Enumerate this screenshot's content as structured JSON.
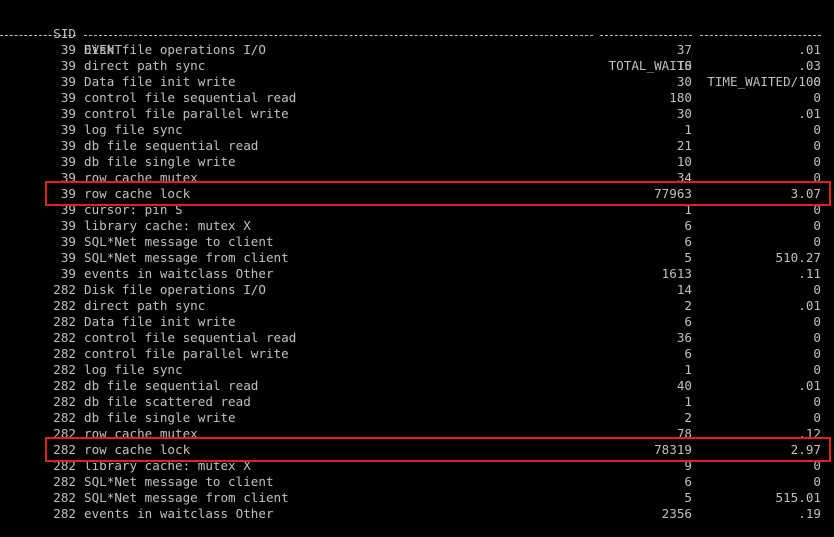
{
  "header": {
    "sid": "SID",
    "event": "EVENT",
    "total_waits": "TOTAL_WAITS",
    "time_waited": "TIME_WAITED/100"
  },
  "rows": [
    {
      "sid": "39",
      "event": "Disk file operations I/O",
      "total_waits": "37",
      "time_waited": ".01"
    },
    {
      "sid": "39",
      "event": "direct path sync",
      "total_waits": "10",
      "time_waited": ".03"
    },
    {
      "sid": "39",
      "event": "Data file init write",
      "total_waits": "30",
      "time_waited": "0"
    },
    {
      "sid": "39",
      "event": "control file sequential read",
      "total_waits": "180",
      "time_waited": "0"
    },
    {
      "sid": "39",
      "event": "control file parallel write",
      "total_waits": "30",
      "time_waited": ".01"
    },
    {
      "sid": "39",
      "event": "log file sync",
      "total_waits": "1",
      "time_waited": "0"
    },
    {
      "sid": "39",
      "event": "db file sequential read",
      "total_waits": "21",
      "time_waited": "0"
    },
    {
      "sid": "39",
      "event": "db file single write",
      "total_waits": "10",
      "time_waited": "0"
    },
    {
      "sid": "39",
      "event": "row cache mutex",
      "total_waits": "34",
      "time_waited": "0"
    },
    {
      "sid": "39",
      "event": "row cache lock",
      "total_waits": "77963",
      "time_waited": "3.07"
    },
    {
      "sid": "39",
      "event": "cursor: pin S",
      "total_waits": "1",
      "time_waited": "0"
    },
    {
      "sid": "39",
      "event": "library cache: mutex X",
      "total_waits": "6",
      "time_waited": "0"
    },
    {
      "sid": "39",
      "event": "SQL*Net message to client",
      "total_waits": "6",
      "time_waited": "0"
    },
    {
      "sid": "39",
      "event": "SQL*Net message from client",
      "total_waits": "5",
      "time_waited": "510.27"
    },
    {
      "sid": "39",
      "event": "events in waitclass Other",
      "total_waits": "1613",
      "time_waited": ".11"
    },
    {
      "sid": "282",
      "event": "Disk file operations I/O",
      "total_waits": "14",
      "time_waited": "0"
    },
    {
      "sid": "282",
      "event": "direct path sync",
      "total_waits": "2",
      "time_waited": ".01"
    },
    {
      "sid": "282",
      "event": "Data file init write",
      "total_waits": "6",
      "time_waited": "0"
    },
    {
      "sid": "282",
      "event": "control file sequential read",
      "total_waits": "36",
      "time_waited": "0"
    },
    {
      "sid": "282",
      "event": "control file parallel write",
      "total_waits": "6",
      "time_waited": "0"
    },
    {
      "sid": "282",
      "event": "log file sync",
      "total_waits": "1",
      "time_waited": "0"
    },
    {
      "sid": "282",
      "event": "db file sequential read",
      "total_waits": "40",
      "time_waited": ".01"
    },
    {
      "sid": "282",
      "event": "db file scattered read",
      "total_waits": "1",
      "time_waited": "0"
    },
    {
      "sid": "282",
      "event": "db file single write",
      "total_waits": "2",
      "time_waited": "0"
    },
    {
      "sid": "282",
      "event": "row cache mutex",
      "total_waits": "78",
      "time_waited": ".12"
    },
    {
      "sid": "282",
      "event": "row cache lock",
      "total_waits": "78319",
      "time_waited": "2.97"
    },
    {
      "sid": "282",
      "event": "library cache: mutex X",
      "total_waits": "9",
      "time_waited": "0"
    },
    {
      "sid": "282",
      "event": "SQL*Net message to client",
      "total_waits": "6",
      "time_waited": "0"
    },
    {
      "sid": "282",
      "event": "SQL*Net message from client",
      "total_waits": "5",
      "time_waited": "515.01"
    },
    {
      "sid": "282",
      "event": "events in waitclass Other",
      "total_waits": "2356",
      "time_waited": ".19"
    }
  ],
  "highlighted_rows": [
    9,
    25
  ],
  "colors": {
    "background": "#000000",
    "text": "#c0c0c0",
    "highlight_border": "#e0201c"
  }
}
